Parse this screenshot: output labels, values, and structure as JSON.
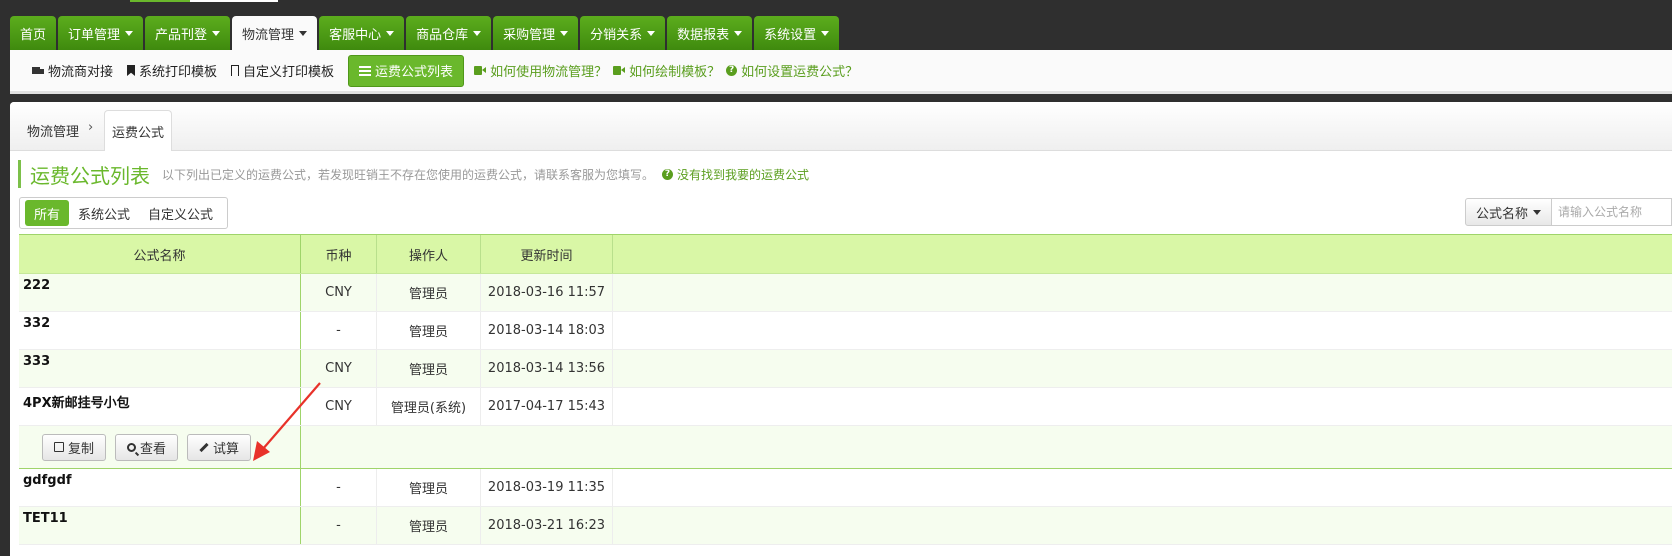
{
  "nav": {
    "tabs": [
      {
        "label": "首页",
        "caret": false
      },
      {
        "label": "订单管理",
        "caret": true
      },
      {
        "label": "产品刊登",
        "caret": true
      },
      {
        "label": "物流管理",
        "caret": true
      },
      {
        "label": "客服中心",
        "caret": true
      },
      {
        "label": "商品仓库",
        "caret": true
      },
      {
        "label": "采购管理",
        "caret": true
      },
      {
        "label": "分销关系",
        "caret": true
      },
      {
        "label": "数据报表",
        "caret": true
      },
      {
        "label": "系统设置",
        "caret": true
      }
    ]
  },
  "subnav": {
    "items": [
      {
        "label": "物流商对接",
        "icon": "truck-icon"
      },
      {
        "label": "系统打印模板",
        "icon": "bookmark-icon"
      },
      {
        "label": "自定义打印模板",
        "icon": "bookmark-outline-icon"
      },
      {
        "label": "运费公式列表",
        "icon": "list-icon"
      }
    ],
    "help_links": [
      {
        "label": "如何使用物流管理？",
        "icon": "video-icon"
      },
      {
        "label": "如何绘制模板？",
        "icon": "video-icon"
      },
      {
        "label": "如何设置运费公式？",
        "icon": "question-circle-icon"
      }
    ]
  },
  "breadcrumb": {
    "home": "物流管理",
    "separator": "›",
    "current": "运费公式"
  },
  "page": {
    "title": "运费公式列表",
    "description": "以下列出已定义的运费公式，若发现旺销王不存在您使用的运费公式，请联系客服为您填写。",
    "link": "没有找到我要的运费公式"
  },
  "filters": [
    "所有",
    "系统公式",
    "自定义公式"
  ],
  "search": {
    "field": "公式名称",
    "placeholder": "请输入公式名称"
  },
  "table": {
    "headers": [
      "公式名称",
      "币种",
      "操作人",
      "更新时间"
    ],
    "rows_before_actions": [
      {
        "name": "222",
        "currency": "CNY",
        "operator": "管理员",
        "updated": "2018-03-16 11:57"
      },
      {
        "name": "332",
        "currency": "-",
        "operator": "管理员",
        "updated": "2018-03-14 18:03"
      },
      {
        "name": "333",
        "currency": "CNY",
        "operator": "管理员",
        "updated": "2018-03-14 13:56"
      },
      {
        "name": "4PX新邮挂号小包",
        "currency": "CNY",
        "operator": "管理员(系统)",
        "updated": "2017-04-17 15:43"
      }
    ],
    "actions": [
      "复制",
      "查看",
      "试算"
    ],
    "rows_after_actions": [
      {
        "name": "gdfgdf",
        "currency": "-",
        "operator": "管理员",
        "updated": "2018-03-19 11:35"
      },
      {
        "name": "TET11",
        "currency": "-",
        "operator": "管理员",
        "updated": "2018-03-21 16:23"
      }
    ]
  },
  "colors": {
    "brand_green": "#4f9a14",
    "header_green": "#d9f7a6",
    "annotation_red": "#e8322a"
  }
}
